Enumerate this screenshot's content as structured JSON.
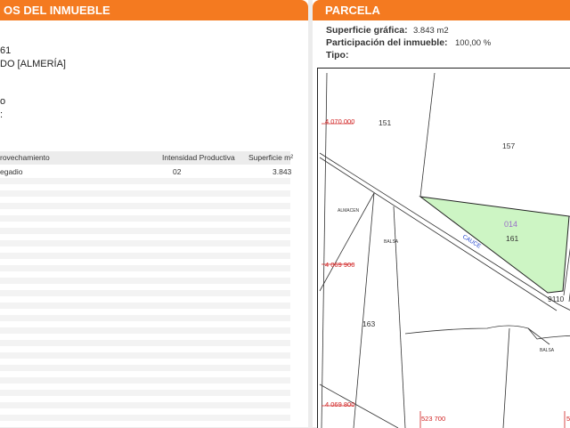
{
  "left_panel": {
    "title": "OS DEL INMUEBLE",
    "line1": "61",
    "line2": "DO [ALMERÍA]",
    "line3": "o",
    "line4": ":",
    "table": {
      "headers": [
        "rovechamiento",
        "Intensidad Productiva",
        "Superficie m²"
      ],
      "rows": [
        [
          "egadio",
          "02",
          "3.843"
        ]
      ]
    }
  },
  "right_panel": {
    "title": "PARCELA",
    "fields": [
      {
        "label": "Superficie gráfica:",
        "value": "3.843 m2"
      },
      {
        "label": "Participación del inmueble:",
        "value": "100,00 %"
      },
      {
        "label": "Tipo:",
        "value": ""
      }
    ]
  },
  "map": {
    "labels": {
      "coord_y1": "4 070 000",
      "coord_y2": "4 069 900",
      "coord_y3": "4 069 800",
      "coord_x1": "523 700",
      "coord_x2": "5",
      "p151": "151",
      "p157": "157",
      "p014": "014",
      "p161": "161",
      "p163": "163",
      "p9110": "9110",
      "almacen": "ALMACEN",
      "balsa1": "BALSA",
      "balsa2": "BALSA",
      "cauce": "CAUCE"
    },
    "colors": {
      "parcel_fill": "#cdf5c4",
      "coord_red": "#d02020",
      "parcel_id": "#9a6fc8",
      "cauce_blue": "#2244cc"
    }
  }
}
